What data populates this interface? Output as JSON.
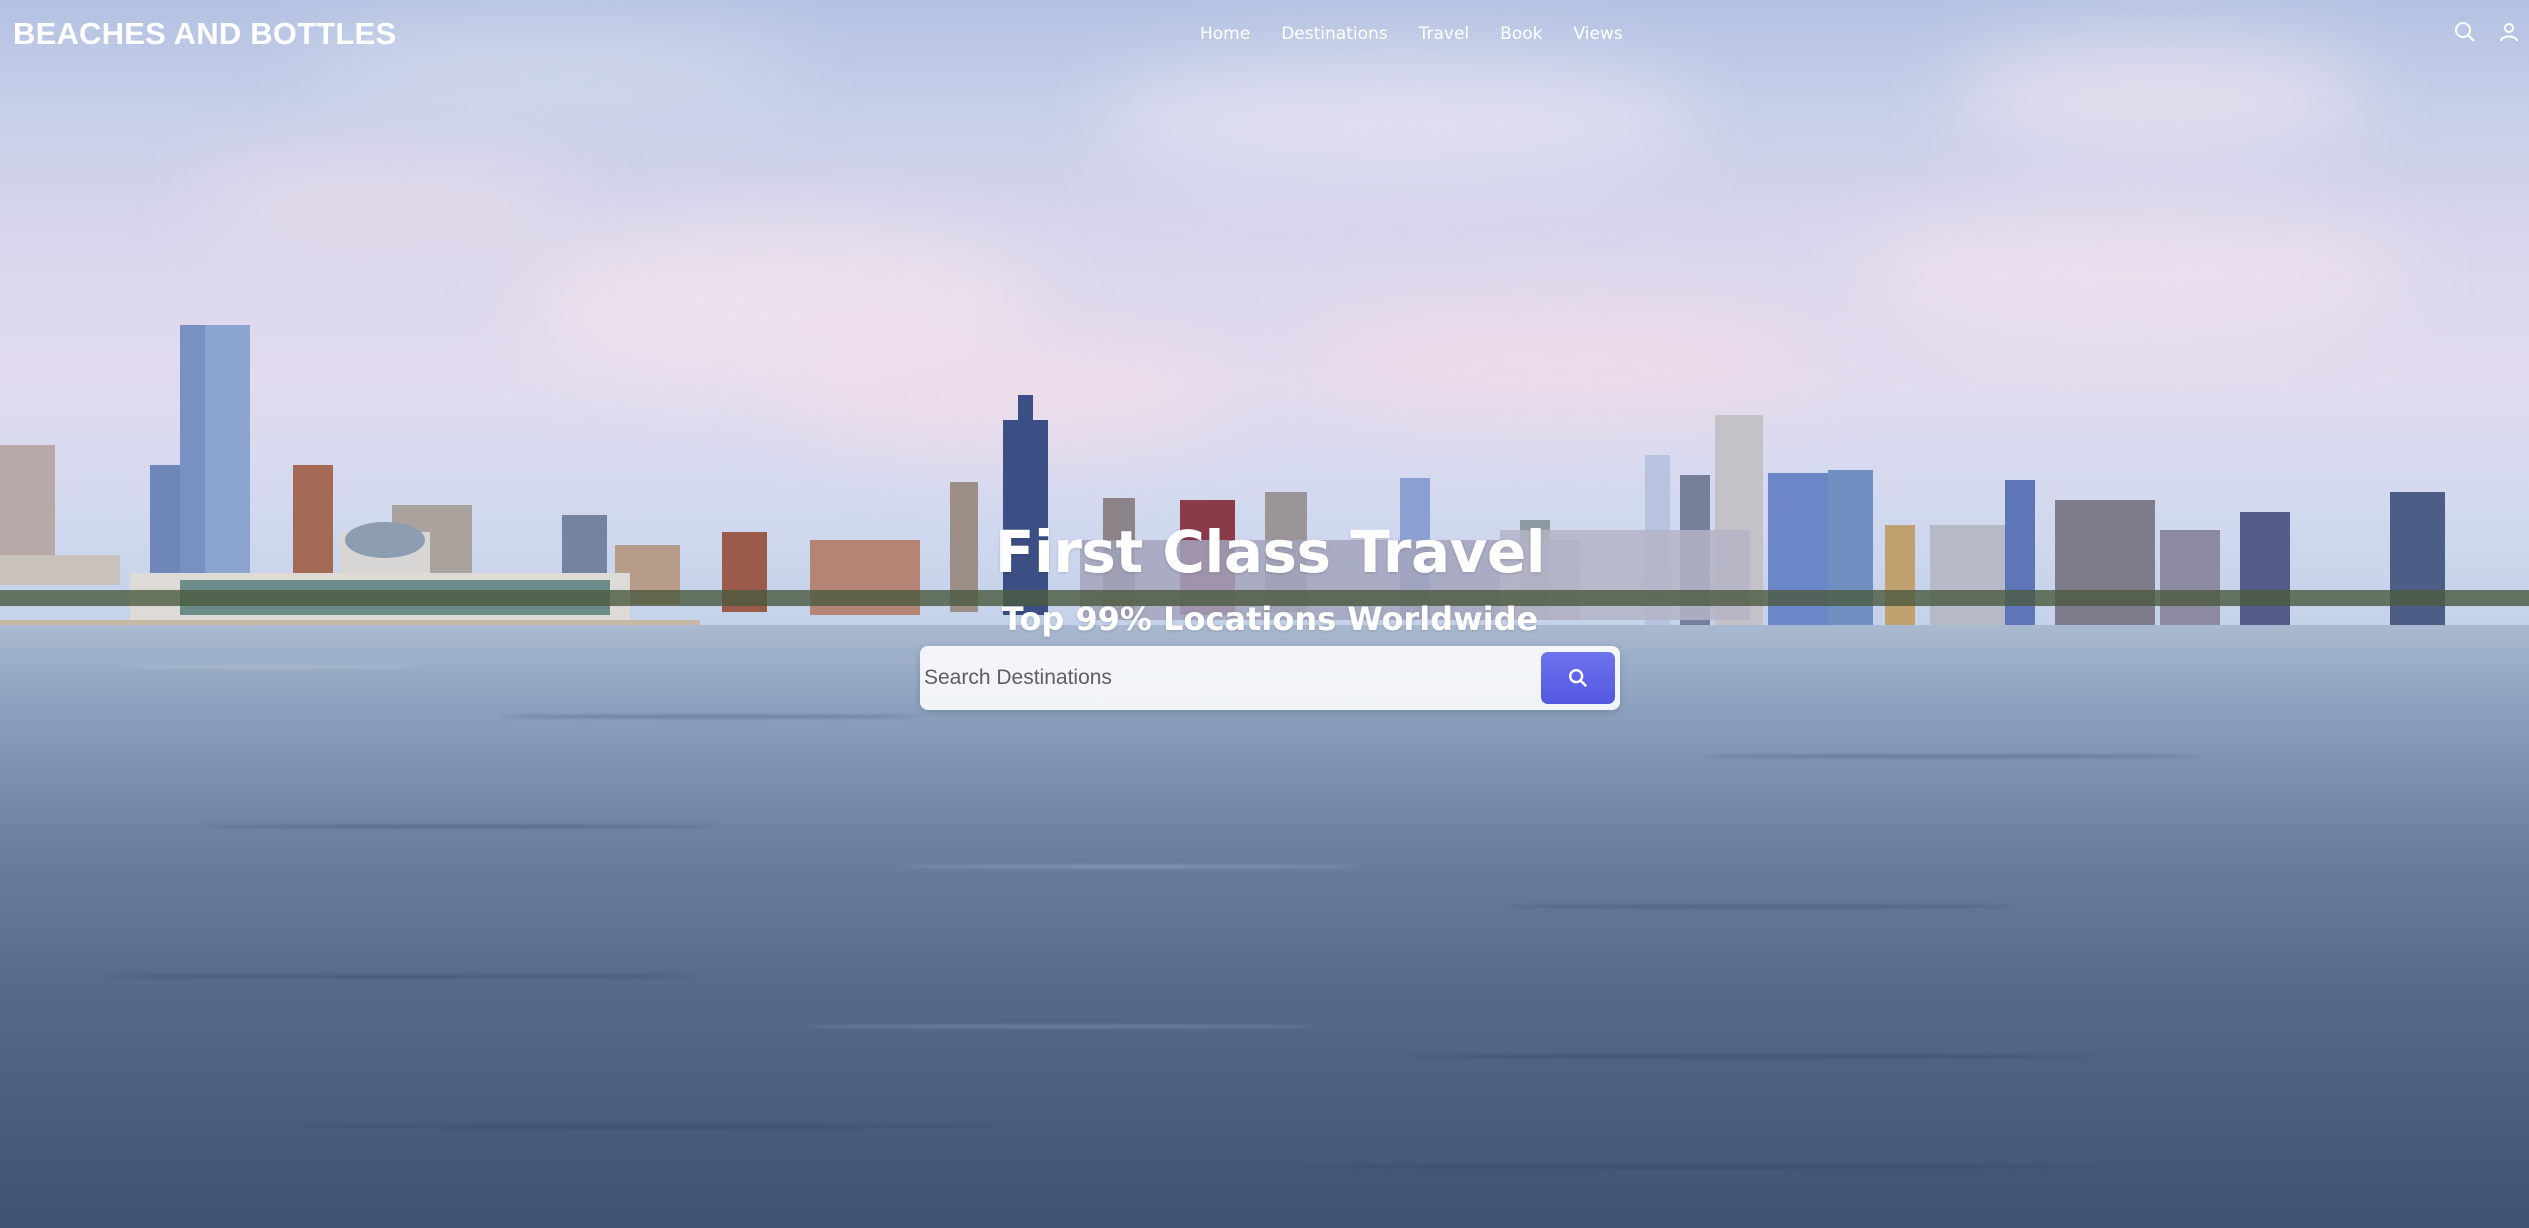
{
  "header": {
    "logo": "BEACHES AND BOTTLES",
    "nav": [
      {
        "label": "Home"
      },
      {
        "label": "Destinations"
      },
      {
        "label": "Travel"
      },
      {
        "label": "Book"
      },
      {
        "label": "Views"
      }
    ],
    "icons": [
      "search-icon",
      "user-icon"
    ]
  },
  "hero": {
    "title": "First Class Travel",
    "subtitle": "Top 99% Locations Worldwide",
    "background": "city-skyline-over-lake"
  },
  "search": {
    "placeholder": "Search Destinations",
    "value": "",
    "button_icon": "search-icon",
    "button_color": "#5b5fe6"
  }
}
